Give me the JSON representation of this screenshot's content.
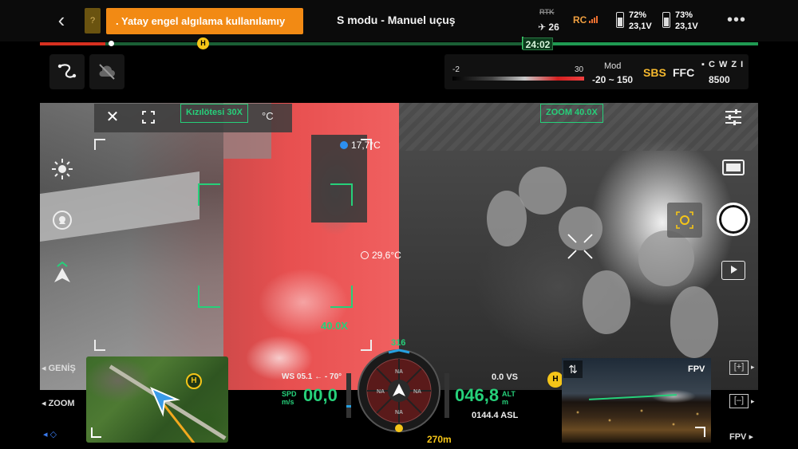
{
  "topbar": {
    "warning_banner": ". Yatay engel algılama kullanılamıy",
    "warning_small": "?",
    "flight_mode": "S modu - Manuel uçuş",
    "rtk_label": "RTK",
    "satellite_count": "26",
    "rc_label": "RC",
    "battery_1": {
      "percent": "72%",
      "voltage": "23,1V"
    },
    "battery_2": {
      "percent": "73%",
      "voltage": "23,1V"
    },
    "more": "•••"
  },
  "flight_time": "24:02",
  "home_marker": "H",
  "thermal_panel": {
    "range_min": "-2",
    "range_max": "30",
    "mode_label": "Mod",
    "mode_range": "-20 ~ 150",
    "sbs": "SBS",
    "ffc": "FFC",
    "cwzi": "C W Z I",
    "iso_value": "8500"
  },
  "camera": {
    "close": "✕",
    "thermal_zoom_label": "Kızılötesi 30X",
    "temp_unit": "°C",
    "zoom_camera_label": "ZOOM 40.0X",
    "temp_high": "17,7°C",
    "temp_low": "29,6°C",
    "zoom_factor": "40.0X"
  },
  "colors": {
    "accent_green": "#26d07a",
    "warning_orange": "#f28a14",
    "home_yellow": "#f5c518",
    "temp_blue": "#2c8ff0"
  },
  "sidebar_left": {
    "wide_label": "◂ GENİŞ",
    "zoom_label": "◂ ZOOM"
  },
  "telemetry": {
    "wind": "WS 05.1 ← - 70°",
    "spd_label_1": "SPD",
    "spd_label_2": "m/s",
    "speed": "00,0",
    "altitude": "046,8",
    "alt_label_1": "ALT",
    "alt_label_2": "m",
    "vertical_speed": "0.0 VS",
    "asl": "0144.4 ASL",
    "heading": "316",
    "distance": "270m",
    "compass_na": "NA"
  },
  "fpv": {
    "label": "FPV",
    "bottom_label": "FPV ▸",
    "swap": "⇅",
    "zoom_in": "[+]",
    "zoom_out": "[–]",
    "side_arrow": "▸"
  }
}
